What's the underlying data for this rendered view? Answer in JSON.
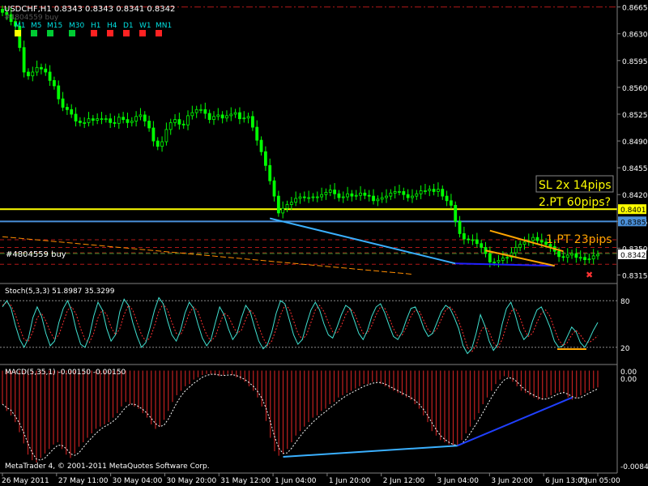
{
  "chart_data": {
    "type": "candlestick",
    "symbol_title": "USDCHF,H1  0.8343 0.8343 0.8341 0.8342",
    "timeframes": [
      {
        "label": "M1",
        "color": "#ffff00",
        "selected": true
      },
      {
        "label": "M5",
        "color": "#00cc33"
      },
      {
        "label": "M15",
        "color": "#00cc33"
      },
      {
        "label": "M30",
        "color": "#00cc33"
      },
      {
        "label": "H1",
        "color": "#ff2222"
      },
      {
        "label": "H4",
        "color": "#ff2222"
      },
      {
        "label": "D1",
        "color": "#ff2222"
      },
      {
        "label": "W1",
        "color": "#ff2222"
      },
      {
        "label": "MN1",
        "color": "#ff2222"
      }
    ],
    "price_axis": {
      "ticks": [
        "0.8665",
        "0.8630",
        "0.8595",
        "0.8560",
        "0.8525",
        "0.8490",
        "0.8455",
        "0.8420",
        "0.8385",
        "0.8350",
        "0.8315"
      ],
      "ylim": [
        0.8306,
        0.8672
      ]
    },
    "price_levels": [
      {
        "name": "yellow-level",
        "price": 0.8401,
        "label": "0.8401",
        "color": "#ffff00",
        "label_bg": "#ffff00",
        "label_color": "#000000"
      },
      {
        "name": "blue-level",
        "price": 0.8385,
        "label": "0.8385",
        "color": "#4a90d9",
        "label_bg": "#4a90d9",
        "label_color": "#000000"
      },
      {
        "name": "current-price",
        "price": 0.8342,
        "label": "0.8342",
        "color": "#a0a0a0",
        "label_bg": "#ffffff",
        "label_color": "#000000"
      }
    ],
    "dashed_levels": [
      0.8665,
      0.8361,
      0.8351,
      0.8344,
      0.8329
    ],
    "order_line": {
      "price": 0.8343,
      "label": "#4804559 buy"
    },
    "hidden_order_label": "#4804559 buy",
    "annotations": [
      {
        "text": "SL 2x 14pips",
        "color": "#ffff00"
      },
      {
        "text": "2.PT 60pips?",
        "color": "#ffff00"
      },
      {
        "text": "1.PT 23pips",
        "color": "#ffa500"
      }
    ],
    "close_series": [
      0.8658,
      0.8655,
      0.8646,
      0.864,
      0.8612,
      0.858,
      0.8575,
      0.858,
      0.8586,
      0.8584,
      0.858,
      0.8569,
      0.8562,
      0.8545,
      0.8534,
      0.8531,
      0.8525,
      0.8516,
      0.8514,
      0.8514,
      0.8519,
      0.8517,
      0.8519,
      0.8519,
      0.8519,
      0.8514,
      0.8513,
      0.8521,
      0.8518,
      0.8514,
      0.8516,
      0.8522,
      0.8524,
      0.8516,
      0.8507,
      0.849,
      0.8483,
      0.8489,
      0.8505,
      0.8514,
      0.8518,
      0.8512,
      0.8511,
      0.8523,
      0.8527,
      0.8531,
      0.8531,
      0.8526,
      0.8518,
      0.8522,
      0.8524,
      0.852,
      0.8523,
      0.8525,
      0.8527,
      0.8519,
      0.852,
      0.8522,
      0.8508,
      0.8491,
      0.8476,
      0.8458,
      0.8438,
      0.8418,
      0.8396,
      0.8402,
      0.8407,
      0.841,
      0.8415,
      0.8417,
      0.8416,
      0.8416,
      0.8417,
      0.8417,
      0.842,
      0.8423,
      0.8426,
      0.8421,
      0.8416,
      0.8417,
      0.8421,
      0.8418,
      0.8419,
      0.8422,
      0.8419,
      0.8418,
      0.8412,
      0.8414,
      0.8416,
      0.8418,
      0.8422,
      0.8424,
      0.8424,
      0.842,
      0.8416,
      0.8418,
      0.8421,
      0.8425,
      0.8425,
      0.8427,
      0.8424,
      0.8427,
      0.8418,
      0.8412,
      0.8406,
      0.8385,
      0.8369,
      0.8362,
      0.8361,
      0.8361,
      0.8356,
      0.8351,
      0.8343,
      0.8332,
      0.8332,
      0.8334,
      0.8337,
      0.8338,
      0.8344,
      0.8351,
      0.8355,
      0.8358,
      0.836,
      0.8364,
      0.836,
      0.8358,
      0.8355,
      0.8352,
      0.8346,
      0.8339,
      0.8338,
      0.8341,
      0.8343,
      0.8338,
      0.8338,
      0.8335,
      0.8336,
      0.834,
      0.8342
    ],
    "trendlines": [
      {
        "name": "price-blue-trendline",
        "from": [
          62,
          0.8389
        ],
        "to": [
          105,
          0.833
        ],
        "color": "#3ab0ff"
      },
      {
        "name": "price-navy-trendline",
        "from": [
          105,
          0.833
        ],
        "to": [
          128,
          0.8327
        ],
        "color": "#2020ff"
      },
      {
        "name": "orange-channel-top",
        "from": [
          113,
          0.8373
        ],
        "to": [
          130,
          0.8346
        ],
        "color": "#ffa500"
      },
      {
        "name": "orange-channel-bottom",
        "from": [
          112,
          0.8347
        ],
        "to": [
          128,
          0.8327
        ],
        "color": "#ffa500"
      },
      {
        "name": "orange-long-trendline",
        "from": [
          0,
          0.8365
        ],
        "to": [
          95,
          0.8316
        ],
        "color": "#ff8c00"
      }
    ],
    "stoch": {
      "title": "Stoch(5,3,3) 51.8987 35.3299",
      "ticks": [
        "80",
        "20"
      ],
      "ylim": [
        0,
        100
      ],
      "k": [
        72,
        80,
        70,
        48,
        30,
        20,
        32,
        58,
        72,
        60,
        38,
        22,
        28,
        52,
        70,
        80,
        66,
        42,
        24,
        20,
        34,
        60,
        78,
        68,
        44,
        28,
        36,
        66,
        82,
        74,
        52,
        34,
        20,
        26,
        46,
        68,
        84,
        76,
        54,
        36,
        28,
        42,
        64,
        78,
        70,
        50,
        32,
        22,
        30,
        52,
        72,
        62,
        44,
        30,
        38,
        58,
        74,
        66,
        46,
        28,
        18,
        24,
        40,
        64,
        80,
        76,
        56,
        36,
        24,
        30,
        50,
        68,
        78,
        68,
        50,
        36,
        32,
        46,
        62,
        74,
        70,
        54,
        38,
        30,
        42,
        60,
        72,
        76,
        64,
        48,
        34,
        30,
        40,
        56,
        70,
        72,
        60,
        44,
        34,
        38,
        52,
        66,
        74,
        70,
        58,
        44,
        22,
        12,
        18,
        38,
        62,
        48,
        28,
        16,
        24,
        50,
        70,
        78,
        62,
        42,
        30,
        36,
        54,
        68,
        72,
        60,
        46,
        28,
        20,
        22,
        34,
        46,
        40,
        26,
        20,
        30,
        42,
        52
      ],
      "d": [
        74,
        78,
        74,
        62,
        44,
        30,
        28,
        40,
        58,
        64,
        54,
        40,
        30,
        36,
        52,
        68,
        72,
        62,
        44,
        30,
        26,
        38,
        58,
        68,
        62,
        46,
        36,
        44,
        62,
        74,
        68,
        52,
        36,
        28,
        32,
        48,
        66,
        76,
        68,
        52,
        38,
        36,
        48,
        64,
        72,
        66,
        50,
        36,
        28,
        34,
        50,
        64,
        60,
        48,
        38,
        42,
        56,
        68,
        62,
        46,
        32,
        22,
        28,
        44,
        62,
        74,
        70,
        54,
        38,
        30,
        36,
        52,
        68,
        74,
        66,
        52,
        40,
        38,
        48,
        62,
        70,
        64,
        50,
        38,
        38,
        48,
        62,
        72,
        70,
        58,
        44,
        34,
        36,
        46,
        60,
        68,
        66,
        54,
        42,
        38,
        44,
        56,
        68,
        72,
        66,
        54,
        38,
        20,
        14,
        22,
        40,
        48,
        40,
        26,
        20,
        30,
        48,
        66,
        70,
        60,
        44,
        34,
        38,
        52,
        64,
        68,
        60,
        44,
        30,
        22,
        26,
        36,
        42,
        36,
        28,
        26,
        30,
        35
      ]
    },
    "macd": {
      "title": "MACD(5,35,1) -0.00150 -0.00150",
      "ticks": [
        "0.00",
        "0.00",
        "-0.00843"
      ],
      "ylim": [
        -0.009,
        0.0004
      ],
      "values": [
        -0.003,
        -0.0036,
        -0.004,
        -0.0046,
        -0.0055,
        -0.0065,
        -0.0075,
        -0.008,
        -0.0082,
        -0.0078,
        -0.0074,
        -0.007,
        -0.0066,
        -0.0064,
        -0.007,
        -0.0075,
        -0.0078,
        -0.0074,
        -0.0068,
        -0.0064,
        -0.006,
        -0.0056,
        -0.0052,
        -0.005,
        -0.0048,
        -0.0046,
        -0.0042,
        -0.0038,
        -0.0032,
        -0.0028,
        -0.003,
        -0.0032,
        -0.0034,
        -0.0038,
        -0.0042,
        -0.0048,
        -0.0052,
        -0.005,
        -0.0044,
        -0.0036,
        -0.0028,
        -0.0022,
        -0.0018,
        -0.0014,
        -0.0012,
        -0.0008,
        -0.0006,
        -0.0004,
        -0.0003,
        -0.0003,
        -0.0004,
        -0.0005,
        -0.0004,
        -0.0003,
        -0.0004,
        -0.0006,
        -0.0008,
        -0.001,
        -0.0014,
        -0.0018,
        -0.0024,
        -0.0032,
        -0.0045,
        -0.006,
        -0.0072,
        -0.0076,
        -0.0074,
        -0.007,
        -0.0064,
        -0.0058,
        -0.0054,
        -0.005,
        -0.0046,
        -0.0042,
        -0.004,
        -0.0036,
        -0.0034,
        -0.003,
        -0.0028,
        -0.0024,
        -0.0022,
        -0.002,
        -0.0018,
        -0.0016,
        -0.0014,
        -0.0012,
        -0.0012,
        -0.001,
        -0.001,
        -0.0012,
        -0.0014,
        -0.0016,
        -0.0018,
        -0.002,
        -0.0022,
        -0.0024,
        -0.0026,
        -0.003,
        -0.0034,
        -0.004,
        -0.0046,
        -0.0054,
        -0.0058,
        -0.0062,
        -0.0064,
        -0.0066,
        -0.0068,
        -0.0066,
        -0.0062,
        -0.0056,
        -0.005,
        -0.0044,
        -0.0038,
        -0.003,
        -0.0024,
        -0.0018,
        -0.0012,
        -0.0008,
        -0.0005,
        -0.0006,
        -0.001,
        -0.0014,
        -0.0018,
        -0.002,
        -0.0022,
        -0.0024,
        -0.0026,
        -0.0026,
        -0.0024,
        -0.0022,
        -0.002,
        -0.0019,
        -0.002,
        -0.0024,
        -0.0026,
        -0.0024,
        -0.0022,
        -0.002,
        -0.0018,
        -0.0016,
        -0.0015
      ],
      "trendlines": [
        {
          "name": "macd-lightblue-trendline",
          "from": [
            66,
            -0.0077
          ],
          "to": [
            107,
            -0.0067
          ],
          "color": "#3ab0ff"
        },
        {
          "name": "macd-blue-trendline",
          "from": [
            107,
            -0.0067
          ],
          "to": [
            134,
            -0.0024
          ],
          "color": "#2040ff"
        }
      ]
    },
    "time_axis": {
      "labels": [
        "26 May 2011",
        "27 May 11:00",
        "30 May 04:00",
        "30 May 20:00",
        "31 May 12:00",
        "1 Jun 04:00",
        "1 Jun 20:00",
        "2 Jun 12:00",
        "3 Jun 04:00",
        "3 Jun 20:00",
        "6 Jun 13:00",
        "7 Jun 05:00"
      ]
    },
    "copyright": "MetaTrader 4, © 2001-2011 MetaQuotes Software Corp."
  }
}
